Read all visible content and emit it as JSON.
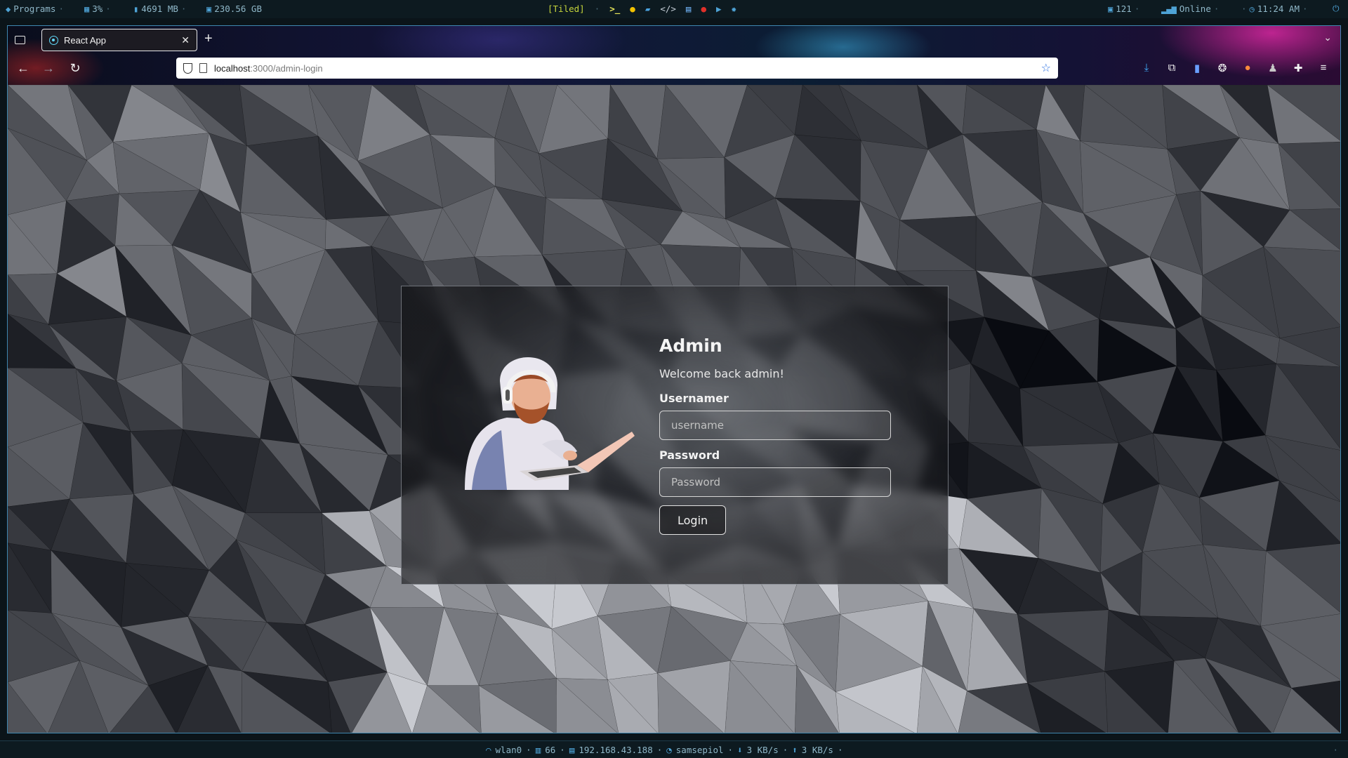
{
  "topbar": {
    "programs": "Programs",
    "cpu": "3%",
    "memory": "4691 MB",
    "disk": "230.56 GB",
    "layout": "[Tiled]",
    "updates": "121",
    "network": "Online",
    "time": "11:24 AM",
    "icons": [
      "terminal-icon",
      "moon-icon",
      "folder-icon",
      "code-icon",
      "notes-icon",
      "chat-icon",
      "youtube-icon",
      "settings-icon"
    ],
    "app_colors": [
      "#e8e65a",
      "#f2c200",
      "#4aa3e0",
      "#c7d0d9",
      "#6aa9e8",
      "#e0302a",
      "#e52d27",
      "#4ea3d6"
    ]
  },
  "browser": {
    "tab_title": "React App",
    "url_host": "localhost",
    "url_path": ":3000/admin-login"
  },
  "login": {
    "heading": "Admin",
    "welcome": "Welcome back admin!",
    "username_label": "Usernamer",
    "username_placeholder": "username",
    "password_label": "Password",
    "password_placeholder": "Password",
    "login_button": "Login"
  },
  "bottombar": {
    "interface": "wlan0",
    "signal": "66",
    "ip": "192.168.43.188",
    "ssid": "samsepiol",
    "download": "3 KB/s",
    "upload": "3 KB/s"
  }
}
